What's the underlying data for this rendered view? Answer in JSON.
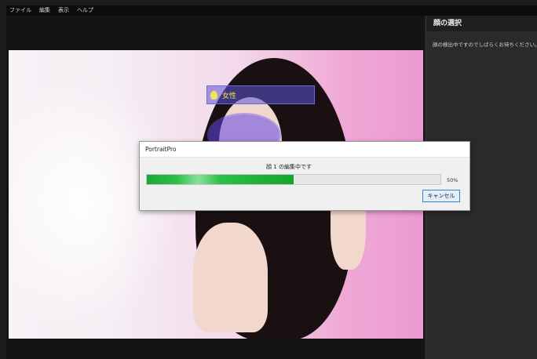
{
  "menu": {
    "items": [
      "ファイル",
      "編集",
      "表示",
      "ヘルプ"
    ]
  },
  "right_panel": {
    "title": "顔の選択",
    "description": "顔の検出中ですのでしばらくお待ちください。"
  },
  "canvas_overlay": {
    "label": "女性"
  },
  "dialog": {
    "title": "PortraitPro",
    "status": "顔 1 の編集中です",
    "percent_label": "50%",
    "progress": 0.5,
    "cancel_label": "キャンセル"
  },
  "colors": {
    "progress": "#13a52d",
    "accent": "#3c7fd6",
    "face_overlay": "#6346e6"
  }
}
